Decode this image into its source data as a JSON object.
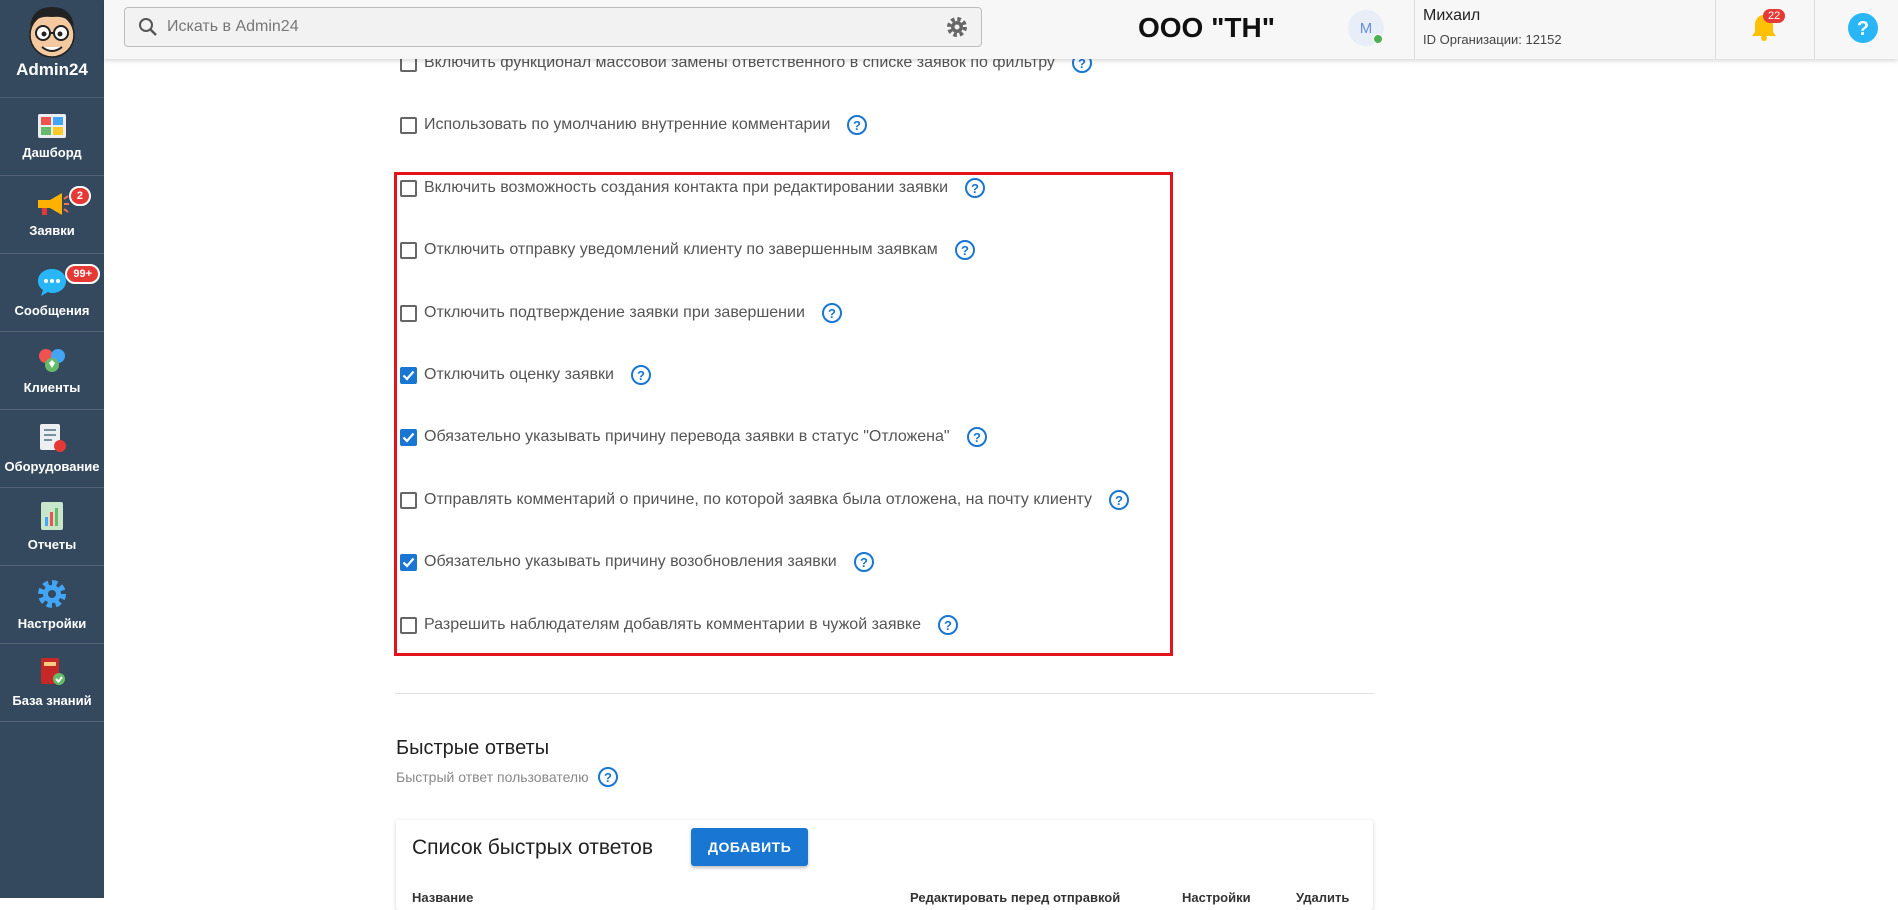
{
  "app": {
    "name": "Admin24"
  },
  "sidebar": {
    "items": [
      {
        "label": "Дашборд",
        "icon": "dashboard-icon",
        "badge": ""
      },
      {
        "label": "Заявки",
        "icon": "megaphone-icon",
        "badge": "2"
      },
      {
        "label": "Сообщения",
        "icon": "chat-icon",
        "badge": "99+"
      },
      {
        "label": "Клиенты",
        "icon": "clients-icon",
        "badge": ""
      },
      {
        "label": "Оборудование",
        "icon": "equipment-icon",
        "badge": ""
      },
      {
        "label": "Отчеты",
        "icon": "reports-icon",
        "badge": ""
      },
      {
        "label": "Настройки",
        "icon": "gear-icon",
        "badge": ""
      },
      {
        "label": "База знаний",
        "icon": "knowledge-base-icon",
        "badge": ""
      }
    ]
  },
  "header": {
    "search_placeholder": "Искать в Admin24",
    "org_name": "ООО \"ТН\"",
    "avatar_letter": "M",
    "user_name": "Михаил",
    "org_id": "ID Организации: 12152",
    "notifications": "22"
  },
  "options": [
    {
      "label": "Включить функционал массовой замены ответственного в списке заявок по фильтру",
      "checked": false
    },
    {
      "label": "Использовать по умолчанию внутренние комментарии",
      "checked": false
    },
    {
      "label": "Включить возможность создания контакта при редактировании заявки",
      "checked": false
    },
    {
      "label": "Отключить отправку уведомлений клиенту по завершенным заявкам",
      "checked": false
    },
    {
      "label": "Отключить подтверждение заявки при завершении",
      "checked": false
    },
    {
      "label": "Отключить оценку заявки",
      "checked": true
    },
    {
      "label": "Обязательно указывать причину перевода заявки в статус \"Отложена\"",
      "checked": true
    },
    {
      "label": "Отправлять комментарий о причине, по которой заявка была отложена, на почту клиенту",
      "checked": false
    },
    {
      "label": "Обязательно указывать причину возобновления заявки",
      "checked": true
    },
    {
      "label": "Разрешить наблюдателям добавлять комментарии в чужой заявке",
      "checked": false
    }
  ],
  "quick_replies": {
    "title": "Быстрые ответы",
    "subtitle": "Быстрый ответ пользователю",
    "list_title": "Список быстрых ответов",
    "add_label": "ДОБАВИТЬ",
    "columns": [
      "Название",
      "Редактировать перед отправкой",
      "Настройки",
      "Удалить"
    ]
  },
  "colors": {
    "sidebar": "#34495e",
    "accent": "#1976d2",
    "highlight": "#e3121b",
    "badge": "#e53935"
  }
}
